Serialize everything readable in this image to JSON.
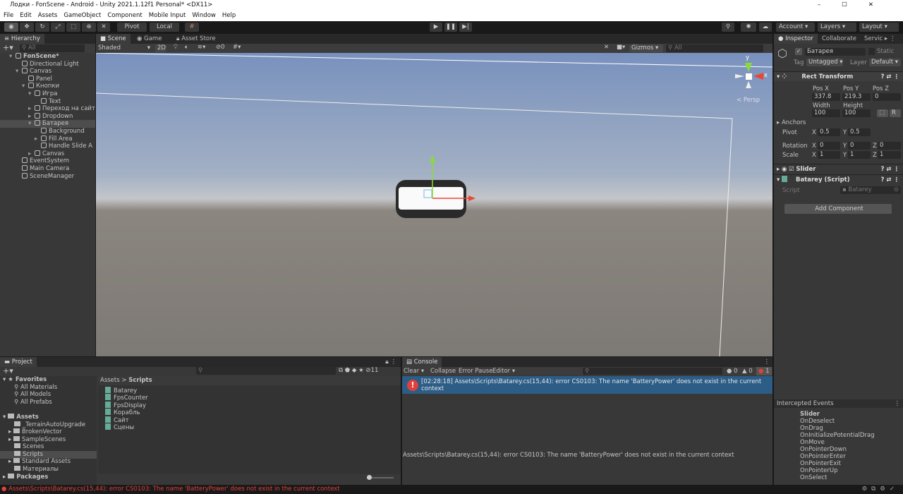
{
  "window": {
    "title": "Лодки - FonScene - Android - Unity 2021.1.12f1 Personal* <DX11>"
  },
  "menu": [
    "File",
    "Edit",
    "Assets",
    "GameObject",
    "Component",
    "Mobile Input",
    "Window",
    "Help"
  ],
  "toolbar": {
    "pivot": "Pivot",
    "local": "Local",
    "account": "Account",
    "layers": "Layers",
    "layout": "Layout"
  },
  "hierarchy": {
    "tab": "Hierarchy",
    "search_placeholder": "All",
    "items": [
      {
        "label": "FonScene*",
        "depth": 0,
        "bold": true
      },
      {
        "label": "Directional Light",
        "depth": 1
      },
      {
        "label": "Canvas",
        "depth": 1
      },
      {
        "label": "Panel",
        "depth": 2
      },
      {
        "label": "Кнопки",
        "depth": 2
      },
      {
        "label": "Игра",
        "depth": 3
      },
      {
        "label": "Text",
        "depth": 4
      },
      {
        "label": "Переход на сайт",
        "depth": 3
      },
      {
        "label": "Dropdown",
        "depth": 3
      },
      {
        "label": "Батарея",
        "depth": 3,
        "selected": true
      },
      {
        "label": "Background",
        "depth": 4
      },
      {
        "label": "Fill Area",
        "depth": 4
      },
      {
        "label": "Handle Slide A",
        "depth": 4
      },
      {
        "label": "Canvas",
        "depth": 3
      },
      {
        "label": "EventSystem",
        "depth": 1
      },
      {
        "label": "Main Camera",
        "depth": 1
      },
      {
        "label": "SceneManager",
        "depth": 1
      }
    ]
  },
  "scene": {
    "tabs": [
      "Scene",
      "Game",
      "Asset Store"
    ],
    "shading": "Shaded",
    "mode_2d": "2D",
    "hidden_count": "0",
    "gizmos": "Gizmos",
    "search_placeholder": "All",
    "persp": "Persp",
    "axis_x": "x",
    "axis_y": "y"
  },
  "inspector": {
    "tabs": [
      "Inspector",
      "Collaborate",
      "Servic"
    ],
    "object_name": "Батарея",
    "static": "Static",
    "tag_label": "Tag",
    "tag": "Untagged",
    "layer_label": "Layer",
    "layer": "Default",
    "rect_transform": {
      "title": "Rect Transform",
      "pos_x_label": "Pos X",
      "pos_y_label": "Pos Y",
      "pos_z_label": "Pos Z",
      "pos_x": "337.8",
      "pos_y": "219.3",
      "pos_z": "0",
      "width_label": "Width",
      "height_label": "Height",
      "width": "100",
      "height": "100",
      "anchors": "Anchors",
      "pivot": "Pivot",
      "pivot_x": "0.5",
      "pivot_y": "0.5",
      "rotation": "Rotation",
      "rot_x": "0",
      "rot_y": "0",
      "rot_z": "0",
      "scale": "Scale",
      "scale_x": "1",
      "scale_y": "1",
      "scale_z": "1",
      "r_button": "R"
    },
    "slider": "Slider",
    "script_comp": "Batarey (Script)",
    "script_label": "Script",
    "script_value": "Batarey",
    "add_component": "Add Component",
    "events_title": "Intercepted Events",
    "events": [
      "Slider",
      "OnDeselect",
      "OnDrag",
      "OnInitializePotentialDrag",
      "OnMove",
      "OnPointerDown",
      "OnPointerEnter",
      "OnPointerExit",
      "OnPointerUp",
      "OnSelect"
    ]
  },
  "project": {
    "tab": "Project",
    "hidden_count": "11",
    "favorites": "Favorites",
    "fav_items": [
      "All Materials",
      "All Models",
      "All Prefabs"
    ],
    "assets": "Assets",
    "folders": [
      "_TerrainAutoUpgrade",
      "BrokenVector",
      "SampleScenes",
      "Scenes",
      "Scripts",
      "Standard Assets",
      "Материалы"
    ],
    "selected_folder": "Scripts",
    "packages": "Packages",
    "breadcrumb": [
      "Assets",
      "Scripts"
    ],
    "files": [
      "Batarey",
      "FpsCounter",
      "FpsDisplay",
      "Корабль",
      "Сайт",
      "Сцены"
    ]
  },
  "console": {
    "tab": "Console",
    "clear": "Clear",
    "collapse": "Collapse",
    "error_pause": "Error Pause",
    "editor": "Editor",
    "info_count": "0",
    "warn_count": "0",
    "error_count": "1",
    "entry": "[02:28:18] Assets\\Scripts\\Batarey.cs(15,44): error CS0103: The name 'BatteryPower' does not exist in the current context",
    "detail": "Assets\\Scripts\\Batarey.cs(15,44): error CS0103: The name 'BatteryPower' does not exist in the current context"
  },
  "status": {
    "message": "Assets\\Scripts\\Batarey.cs(15,44): error CS0103: The name 'BatteryPower' does not exist in the current context",
    "error_color": "#e0403a"
  }
}
